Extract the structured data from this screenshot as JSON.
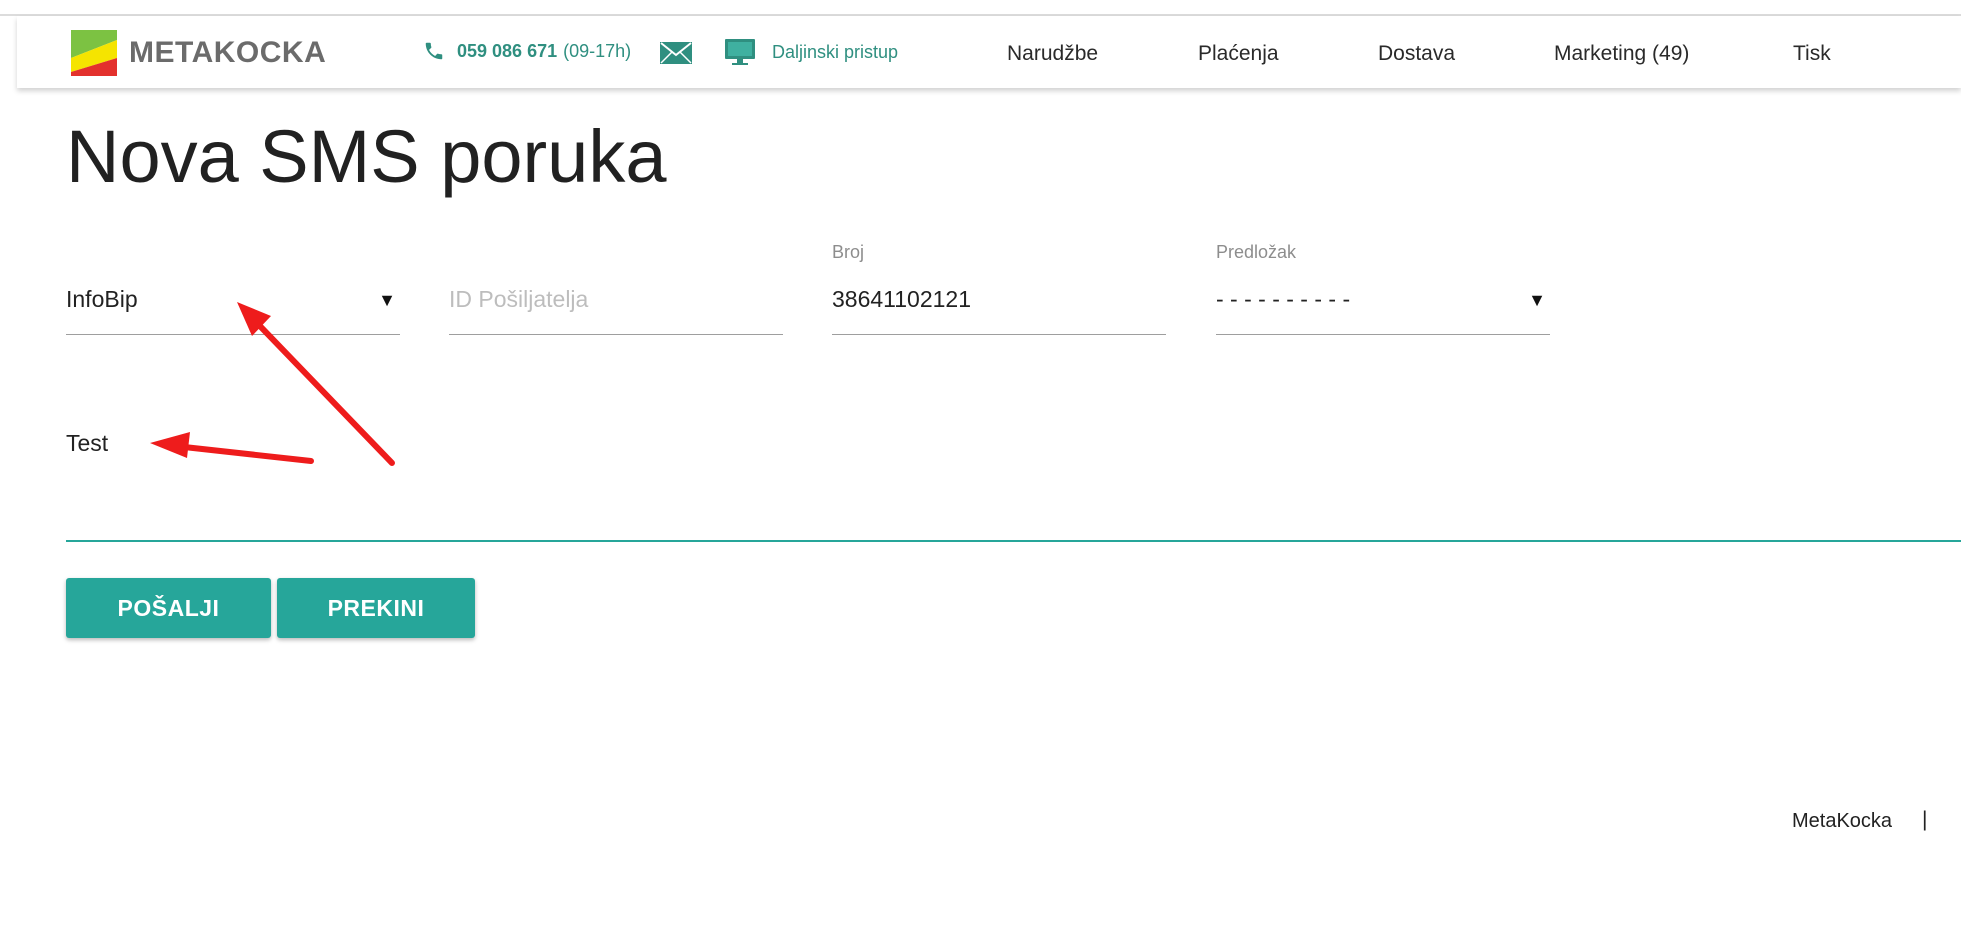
{
  "header": {
    "logo_text": "METAKOCKA",
    "phone_number": "059 086 671",
    "phone_hours": "(09-17h)",
    "remote_label": "Daljinski pristup",
    "nav": [
      "Narudžbe",
      "Plaćenja",
      "Dostava",
      "Marketing (49)",
      "Tisk"
    ]
  },
  "page": {
    "title": "Nova SMS poruka"
  },
  "form": {
    "provider": {
      "value": "InfoBip"
    },
    "sender_id": {
      "placeholder": "ID Pošiljatelja"
    },
    "number": {
      "label": "Broj",
      "value": "38641102121"
    },
    "template": {
      "label": "Predložak",
      "value": "- - - - - - - - - -"
    },
    "message": {
      "value": "Test"
    }
  },
  "buttons": {
    "send": "POŠALJI",
    "cancel": "PREKINI"
  },
  "footer": {
    "brand": "MetaKocka",
    "separator": "|"
  },
  "colors": {
    "accent": "#26a69a",
    "link": "#2f8f80",
    "annotation": "#ee1c1c",
    "logo_green": "#7cc242",
    "logo_yellow": "#f5e400",
    "logo_red": "#e3312d"
  },
  "icons": [
    "phone-icon",
    "mail-icon",
    "monitor-icon",
    "chevron-down-icon"
  ]
}
